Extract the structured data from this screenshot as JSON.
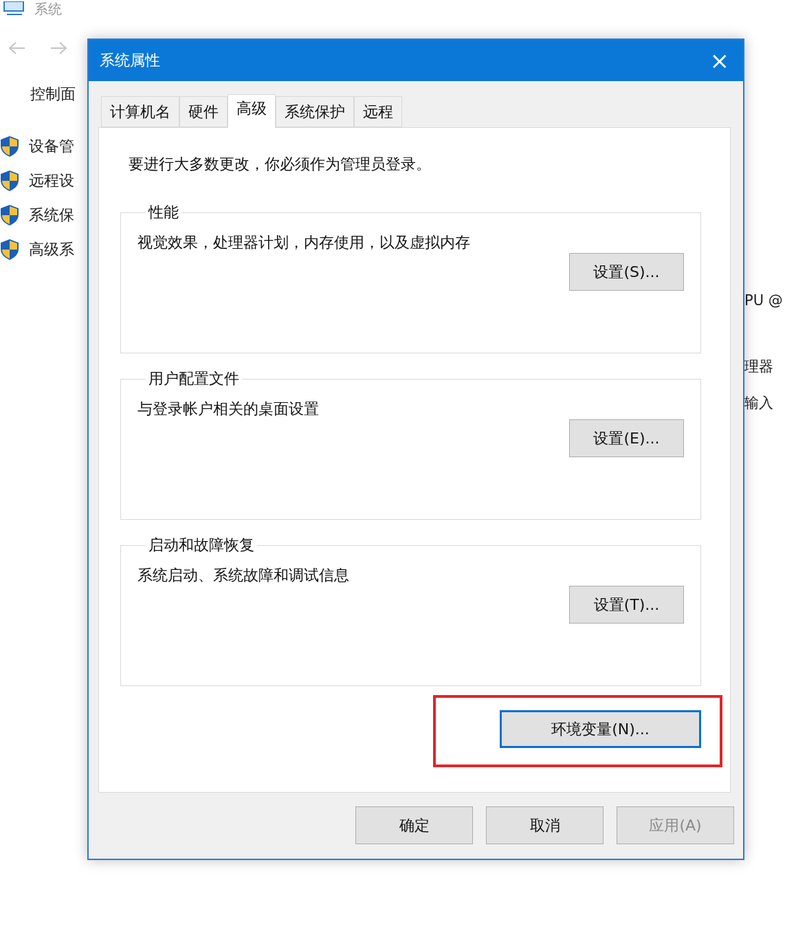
{
  "background_window": {
    "title": "系统",
    "breadcrumb": "控制面",
    "sidebar_items": [
      {
        "label": "设备管"
      },
      {
        "label": "远程设"
      },
      {
        "label": "系统保"
      },
      {
        "label": "高级系"
      }
    ],
    "right_texts": [
      "PU @",
      "理器",
      "输入"
    ]
  },
  "dialog": {
    "title": "系统属性",
    "close": "×",
    "tabs": [
      {
        "label": "计算机名",
        "selected": false
      },
      {
        "label": "硬件",
        "selected": false
      },
      {
        "label": "高级",
        "selected": true
      },
      {
        "label": "系统保护",
        "selected": false
      },
      {
        "label": "远程",
        "selected": false
      }
    ],
    "notice": "要进行大多数更改，你必须作为管理员登录。",
    "groups": [
      {
        "title": "性能",
        "description": "视觉效果，处理器计划，内存使用，以及虚拟内存",
        "button": "设置(S)..."
      },
      {
        "title": "用户配置文件",
        "description": "与登录帐户相关的桌面设置",
        "button": "设置(E)..."
      },
      {
        "title": "启动和故障恢复",
        "description": "系统启动、系统故障和调试信息",
        "button": "设置(T)..."
      }
    ],
    "env_button": {
      "label": "环境变量(N)...",
      "focused": true,
      "highlighted": true
    },
    "buttons": [
      {
        "label": "确定",
        "disabled": false
      },
      {
        "label": "取消",
        "disabled": false
      },
      {
        "label": "应用(A)",
        "disabled": true
      }
    ]
  }
}
